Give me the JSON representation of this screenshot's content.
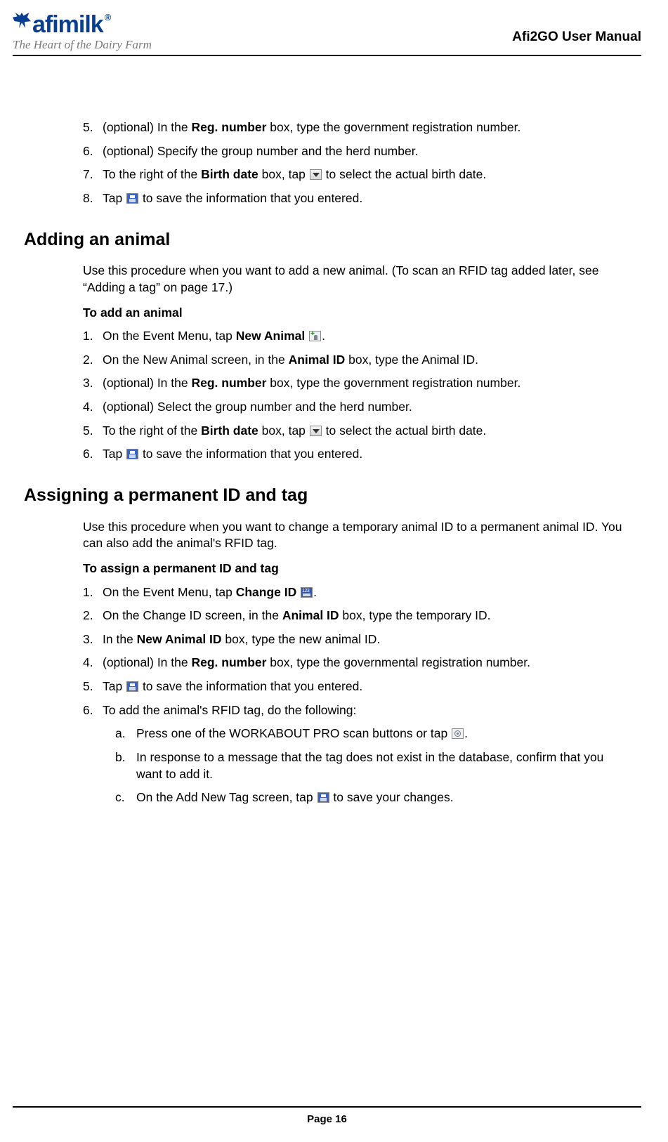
{
  "header": {
    "logo_text": "afimilk",
    "logo_reg": "®",
    "tagline": "The Heart of the Dairy Farm",
    "manual_title": "Afi2GO User Manual"
  },
  "list_a": {
    "items": [
      {
        "n": "5.",
        "pre": "(optional) In the ",
        "b1": "Reg. number",
        "post": " box, type the government registration number."
      },
      {
        "n": "6.",
        "text": "(optional) Specify the group number and the herd number."
      },
      {
        "n": "7.",
        "pre": "To the right of the ",
        "b1": "Birth date",
        "mid": " box, tap ",
        "icon": "dropdown",
        "post": " to select the actual birth date."
      },
      {
        "n": "8.",
        "pre": "Tap ",
        "icon": "save",
        "post": " to save the information that you entered."
      }
    ]
  },
  "section_b": {
    "title": "Adding an animal",
    "intro": "Use this procedure when you want to add a new animal.  (To scan an RFID tag added later, see “Adding a tag” on page 17.)",
    "subhead": "To add an animal",
    "items": [
      {
        "n": "1.",
        "pre": "On the Event Menu, tap ",
        "b1": "New Animal",
        "mid": " ",
        "icon": "newanimal",
        "post": "."
      },
      {
        "n": "2.",
        "pre": "On the New Animal screen, in the ",
        "b1": "Animal ID",
        "post": " box, type the Animal ID."
      },
      {
        "n": "3.",
        "pre": "(optional) In the ",
        "b1": "Reg. number",
        "post": " box, type the government registration number."
      },
      {
        "n": "4.",
        "text": "(optional) Select the group number and the herd number."
      },
      {
        "n": "5.",
        "pre": "To the right of the ",
        "b1": "Birth date",
        "mid": " box, tap ",
        "icon": "dropdown",
        "post": " to select the actual birth date."
      },
      {
        "n": "6.",
        "pre": "Tap ",
        "icon": "save",
        "post": " to save the information that you entered."
      }
    ]
  },
  "section_c": {
    "title": "Assigning a permanent ID and tag",
    "intro": "Use this procedure when you want to change a temporary animal ID to a permanent animal ID.  You can also add the animal's RFID tag.",
    "subhead": "To assign a permanent ID and tag",
    "items": [
      {
        "n": "1.",
        "pre": "On the Event Menu, tap ",
        "b1": "Change ID",
        "mid": " ",
        "icon": "changeid",
        "post": "."
      },
      {
        "n": "2.",
        "pre": "On the Change ID screen, in the ",
        "b1": "Animal ID",
        "post": " box, type the temporary ID."
      },
      {
        "n": "3.",
        "pre": "In the ",
        "b1": "New Animal ID",
        "post": " box, type the new animal ID."
      },
      {
        "n": "4.",
        "pre": "(optional) In the ",
        "b1": "Reg. number",
        "post": " box, type the governmental registration number."
      },
      {
        "n": "5.",
        "pre": "Tap ",
        "icon": "save",
        "post": " to save the information that you entered."
      },
      {
        "n": "6.",
        "text": "To add the animal's RFID tag, do the following:"
      }
    ],
    "subitems": [
      {
        "n": "a.",
        "pre": "Press one of the WORKABOUT PRO scan buttons or tap ",
        "icon": "scan",
        "post": "."
      },
      {
        "n": "b.",
        "text": "In response to a message that the tag does not exist in the database, confirm that you want to add it."
      },
      {
        "n": "c.",
        "pre": "On the Add New Tag screen, tap ",
        "icon": "save",
        "post": " to save your changes."
      }
    ]
  },
  "footer": {
    "page_label": "Page 16"
  }
}
